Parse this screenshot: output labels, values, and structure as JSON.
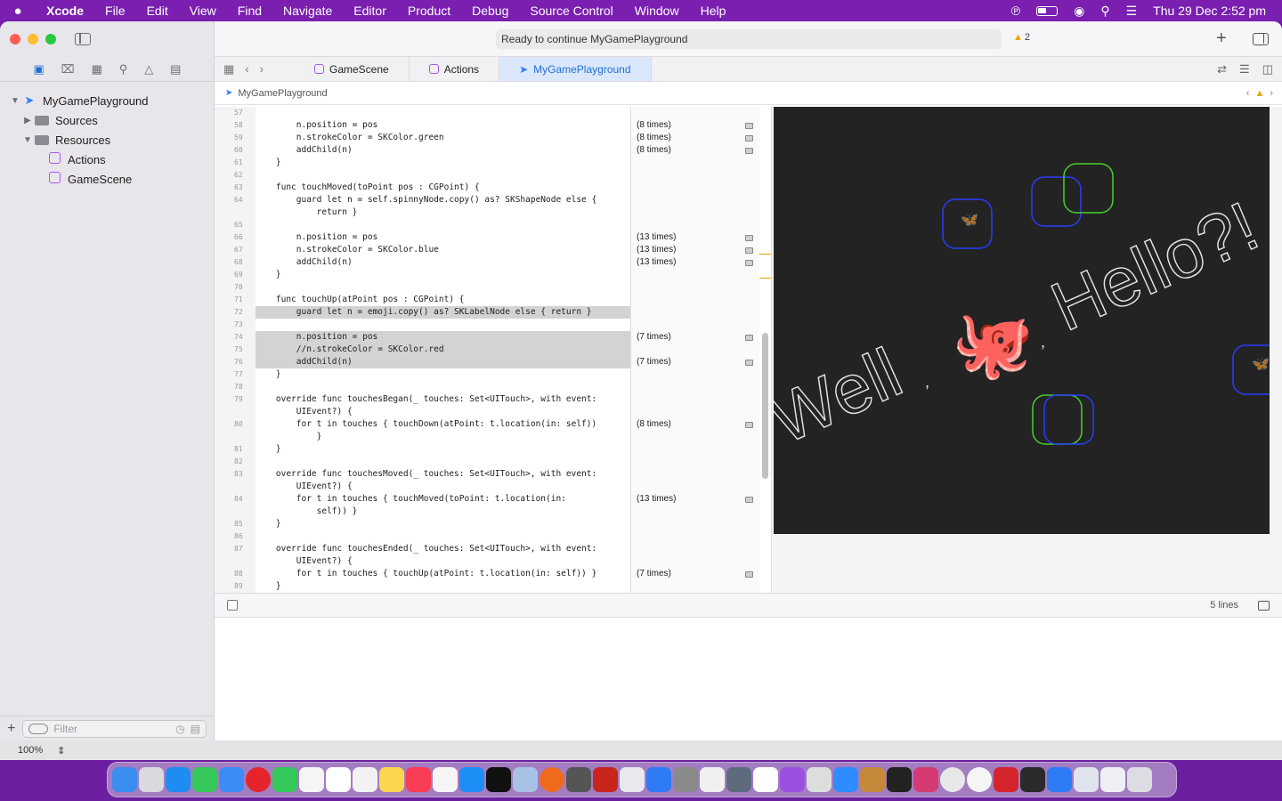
{
  "menubar": {
    "app_name": "Xcode",
    "items": [
      "File",
      "Edit",
      "View",
      "Find",
      "Navigate",
      "Editor",
      "Product",
      "Debug",
      "Source Control",
      "Window",
      "Help"
    ],
    "clock": "Thu 29 Dec  2:52 pm"
  },
  "toolbar": {
    "status": "Ready to continue MyGamePlayground",
    "warning_count": "2"
  },
  "navigator": {
    "items": [
      {
        "label": "MyGamePlayground"
      },
      {
        "label": "Sources"
      },
      {
        "label": "Resources"
      },
      {
        "label": "Actions"
      },
      {
        "label": "GameScene"
      }
    ],
    "filter_placeholder": "Filter"
  },
  "tabs": [
    {
      "label": "GameScene"
    },
    {
      "label": "Actions"
    },
    {
      "label": "MyGamePlayground"
    }
  ],
  "breadcrumb": "MyGamePlayground",
  "code_lines": [
    {
      "n": "57",
      "t": "",
      "r": ""
    },
    {
      "n": "58",
      "t": "        n.position = pos",
      "r": "(8 times)"
    },
    {
      "n": "59",
      "t": "        n.strokeColor = SKColor.green",
      "r": "(8 times)"
    },
    {
      "n": "60",
      "t": "        addChild(n)",
      "r": "(8 times)"
    },
    {
      "n": "61",
      "t": "    }",
      "r": ""
    },
    {
      "n": "62",
      "t": "",
      "r": ""
    },
    {
      "n": "63",
      "t": "    func touchMoved(toPoint pos : CGPoint) {",
      "r": ""
    },
    {
      "n": "64",
      "t": "        guard let n = self.spinnyNode.copy() as? SKShapeNode else {",
      "r": ""
    },
    {
      "n": "",
      "t": "            return }",
      "r": ""
    },
    {
      "n": "65",
      "t": "",
      "r": ""
    },
    {
      "n": "66",
      "t": "        n.position = pos",
      "r": "(13 times)"
    },
    {
      "n": "67",
      "t": "        n.strokeColor = SKColor.blue",
      "r": "(13 times)"
    },
    {
      "n": "68",
      "t": "        addChild(n)",
      "r": "(13 times)"
    },
    {
      "n": "69",
      "t": "    }",
      "r": ""
    },
    {
      "n": "70",
      "t": "",
      "r": ""
    },
    {
      "n": "71",
      "t": "    func touchUp(atPoint pos : CGPoint) {",
      "r": ""
    },
    {
      "n": "72",
      "t": "        guard let n = emoji.copy() as? SKLabelNode else { return }",
      "r": "",
      "hl": true
    },
    {
      "n": "73",
      "t": "",
      "r": "",
      "hl": true
    },
    {
      "n": "74",
      "t": "        n.position = pos",
      "r": "(7 times)",
      "hl": true
    },
    {
      "n": "75",
      "t": "        //n.strokeColor = SKColor.red",
      "r": "",
      "hl": true
    },
    {
      "n": "76",
      "t": "        addChild(n)",
      "r": "(7 times)",
      "hl": true
    },
    {
      "n": "77",
      "t": "    }",
      "r": ""
    },
    {
      "n": "78",
      "t": "",
      "r": ""
    },
    {
      "n": "79",
      "t": "    override func touchesBegan(_ touches: Set<UITouch>, with event:",
      "r": ""
    },
    {
      "n": "",
      "t": "        UIEvent?) {",
      "r": ""
    },
    {
      "n": "80",
      "t": "        for t in touches { touchDown(atPoint: t.location(in: self))",
      "r": "(8 times)"
    },
    {
      "n": "",
      "t": "            }",
      "r": ""
    },
    {
      "n": "81",
      "t": "    }",
      "r": ""
    },
    {
      "n": "82",
      "t": "",
      "r": ""
    },
    {
      "n": "83",
      "t": "    override func touchesMoved(_ touches: Set<UITouch>, with event:",
      "r": ""
    },
    {
      "n": "",
      "t": "        UIEvent?) {",
      "r": ""
    },
    {
      "n": "84",
      "t": "        for t in touches { touchMoved(toPoint: t.location(in:",
      "r": "(13 times)"
    },
    {
      "n": "",
      "t": "            self)) }",
      "r": ""
    },
    {
      "n": "85",
      "t": "    }",
      "r": ""
    },
    {
      "n": "86",
      "t": "",
      "r": ""
    },
    {
      "n": "87",
      "t": "    override func touchesEnded(_ touches: Set<UITouch>, with event:",
      "r": ""
    },
    {
      "n": "",
      "t": "        UIEvent?) {",
      "r": ""
    },
    {
      "n": "88",
      "t": "        for t in touches { touchUp(atPoint: t.location(in: self)) }",
      "r": "(7 times)"
    },
    {
      "n": "89",
      "t": "    }",
      "r": ""
    }
  ],
  "live_view": {
    "text_left": "Well",
    "text_right": "Hello?!",
    "emoji": "🐙",
    "butterfly": "🦋"
  },
  "debug": {
    "lines_label": "5 lines"
  },
  "zoom": "100%"
}
